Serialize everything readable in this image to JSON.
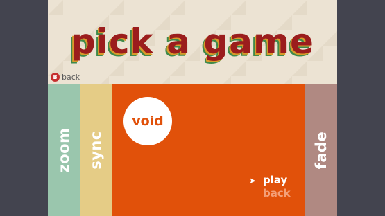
{
  "header": {
    "title": "pick a game",
    "back_hint": {
      "button": "B",
      "label": "back"
    }
  },
  "games": [
    {
      "id": "zoom",
      "label": "zoom",
      "color": "#9ac6ad"
    },
    {
      "id": "sync",
      "label": "sync",
      "color": "#e5cc86"
    },
    {
      "id": "void",
      "label": "void",
      "color": "#e1510a"
    },
    {
      "id": "fade",
      "label": "fade",
      "color": "#b08982"
    }
  ],
  "selected_game": {
    "label": "void",
    "menu": [
      {
        "label": "play",
        "selected": true,
        "color": "#ffffff"
      },
      {
        "label": "back",
        "selected": false,
        "color": "#f4a078"
      }
    ]
  },
  "colors": {
    "background": "#43444f",
    "header_bg": "#ece3d3",
    "title": "#9b1d1d",
    "title_shadow_1": "#d99a2b",
    "title_shadow_2": "#3f8a4a",
    "back_button": "#c62f2f"
  }
}
